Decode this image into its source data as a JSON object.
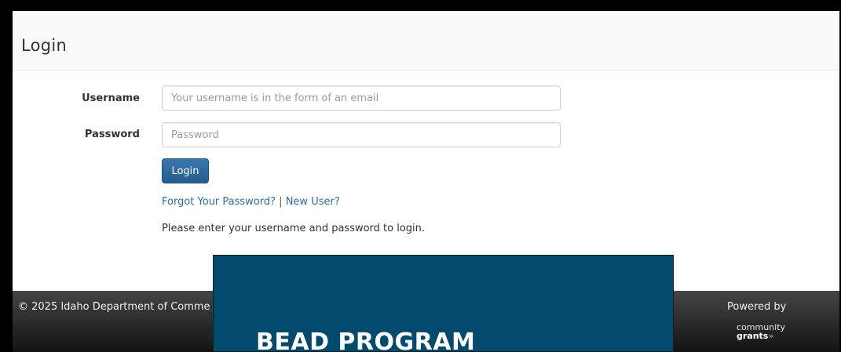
{
  "page": {
    "title": "Login"
  },
  "form": {
    "username_label": "Username",
    "username_placeholder": "Your username is in the form of an email",
    "username_value": "",
    "password_label": "Password",
    "password_placeholder": "Password",
    "password_value": "",
    "login_button": "Login",
    "forgot_link": "Forgot Your Password?",
    "separator": "|",
    "new_user_link": "New User?",
    "help_text": "Please enter your username and password to login."
  },
  "footer": {
    "copyright": "© 2025 Idaho Department of Comme",
    "powered_by": "Powered by",
    "logo_line1": "community",
    "logo_line2": "grants",
    "logo_mark": "»"
  },
  "overlay": {
    "title": "BEAD PROGRAM"
  },
  "colors": {
    "primary_button": "#2d6a9f",
    "link": "#2a6ea8",
    "overlay_bg": "#024a6e",
    "footer_bg": "#2b2b2b"
  }
}
